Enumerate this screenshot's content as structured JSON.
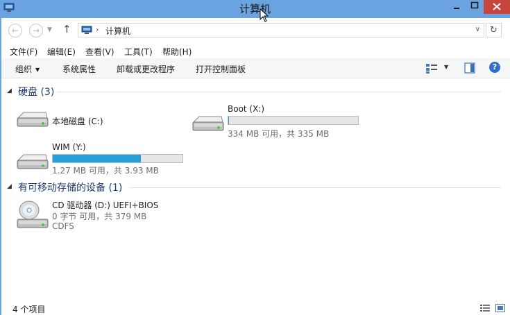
{
  "window": {
    "title": "计算机"
  },
  "address": {
    "crumb": "计算机",
    "separator": "›"
  },
  "menu": [
    "文件(F)",
    "编辑(E)",
    "查看(V)",
    "工具(T)",
    "帮助(H)"
  ],
  "commands": {
    "organize": "组织",
    "system_props": "系统属性",
    "uninstall": "卸载或更改程序",
    "control_panel": "打开控制面板"
  },
  "groups": {
    "hdd": {
      "label": "硬盘 (3)"
    },
    "removable": {
      "label": "有可移动存储的设备 (1)"
    }
  },
  "drives": {
    "c": {
      "name": "本地磁盘 (C:)"
    },
    "x": {
      "name": "Boot (X:)",
      "info": "334 MB 可用，共 335 MB",
      "used_fraction": 0.003
    },
    "y": {
      "name": "WIM (Y:)",
      "info": "1.27 MB 可用，共 3.93 MB",
      "used_fraction": 0.677
    },
    "d": {
      "name": "CD 驱动器 (D:) UEFI+BIOS",
      "info": "0 字节 可用，共 379 MB",
      "fs": "CDFS"
    }
  },
  "status": {
    "count": "4 个项目"
  },
  "colors": {
    "titlebar": "#6ba3e0",
    "capacity_fill": "#26a0da",
    "group_text": "#1e3a6b"
  },
  "icons": [
    "computer-icon",
    "hard-drive-icon",
    "cd-drive-icon",
    "help-icon",
    "refresh-icon",
    "up-arrow-icon"
  ]
}
